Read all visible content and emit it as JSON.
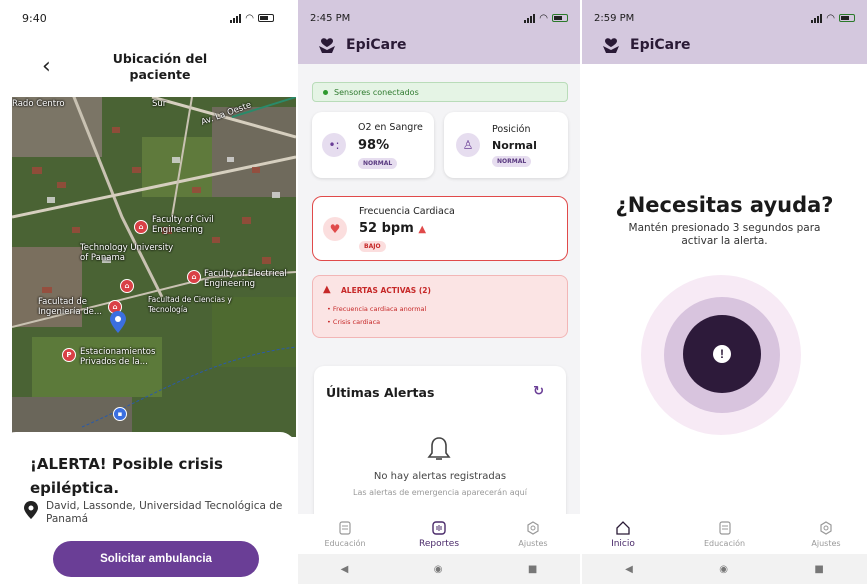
{
  "screen1": {
    "status_time": "9:40",
    "title": "Ubicación del paciente",
    "map_labels": {
      "faculty_civil": "Faculty of Civil Engineering",
      "technology": "Technology University of Panama",
      "faculty_electrical": "Faculty of Electrical Engineering",
      "facultad_ingenieria": "Facultad de Ingeniería de...",
      "facultad_ciencias": "Facultad de Ciencias y Tecnología",
      "estacionamientos": "Estacionamientos Privados de la...",
      "street": "Av. La Oeste",
      "sur": "Sur"
    },
    "alert_title": "¡ALERTA! Posible crisis epiléptica.",
    "location_text": "David, Lassonde, Universidad Tecnológica de Panamá",
    "ambulance_button": "Solicitar ambulancia"
  },
  "screen2": {
    "status_time": "2:45 PM",
    "app_name": "EpiCare",
    "sensors_status": "Sensores conectados",
    "o2": {
      "label": "O2 en Sangre",
      "value": "98%",
      "badge": "NORMAL"
    },
    "position": {
      "label": "Posición",
      "value": "Normal",
      "badge": "NORMAL"
    },
    "heart_rate": {
      "label": "Frecuencia Cardiaca",
      "value": "52 bpm",
      "badge": "BAJO"
    },
    "active_alerts": {
      "title": "ALERTAS ACTIVAS (2)",
      "items": [
        "• Frecuencia cardiaca anormal",
        "• Crisis cardiaca"
      ]
    },
    "last_alerts": {
      "title": "Últimas Alertas",
      "empty": "No hay alertas registradas",
      "empty_sub": "Las alertas de emergencia aparecerán aquí"
    },
    "nav": {
      "educacion": "Educación",
      "reportes": "Reportes",
      "ajustes": "Ajustes"
    }
  },
  "screen3": {
    "status_time": "2:59 PM",
    "app_name": "EpiCare",
    "help_title": "¿Necesitas ayuda?",
    "help_subtitle": "Mantén presionado 3 segundos para activar la alerta.",
    "sos_symbol": "!",
    "nav": {
      "inicio": "Inicio",
      "educacion": "Educación",
      "ajustes": "Ajustes"
    }
  },
  "colors": {
    "primary": "#6a3e96",
    "appbar": "#d4c8de",
    "alert_red": "#e04a4a",
    "sos_core": "#2d1a3a"
  }
}
